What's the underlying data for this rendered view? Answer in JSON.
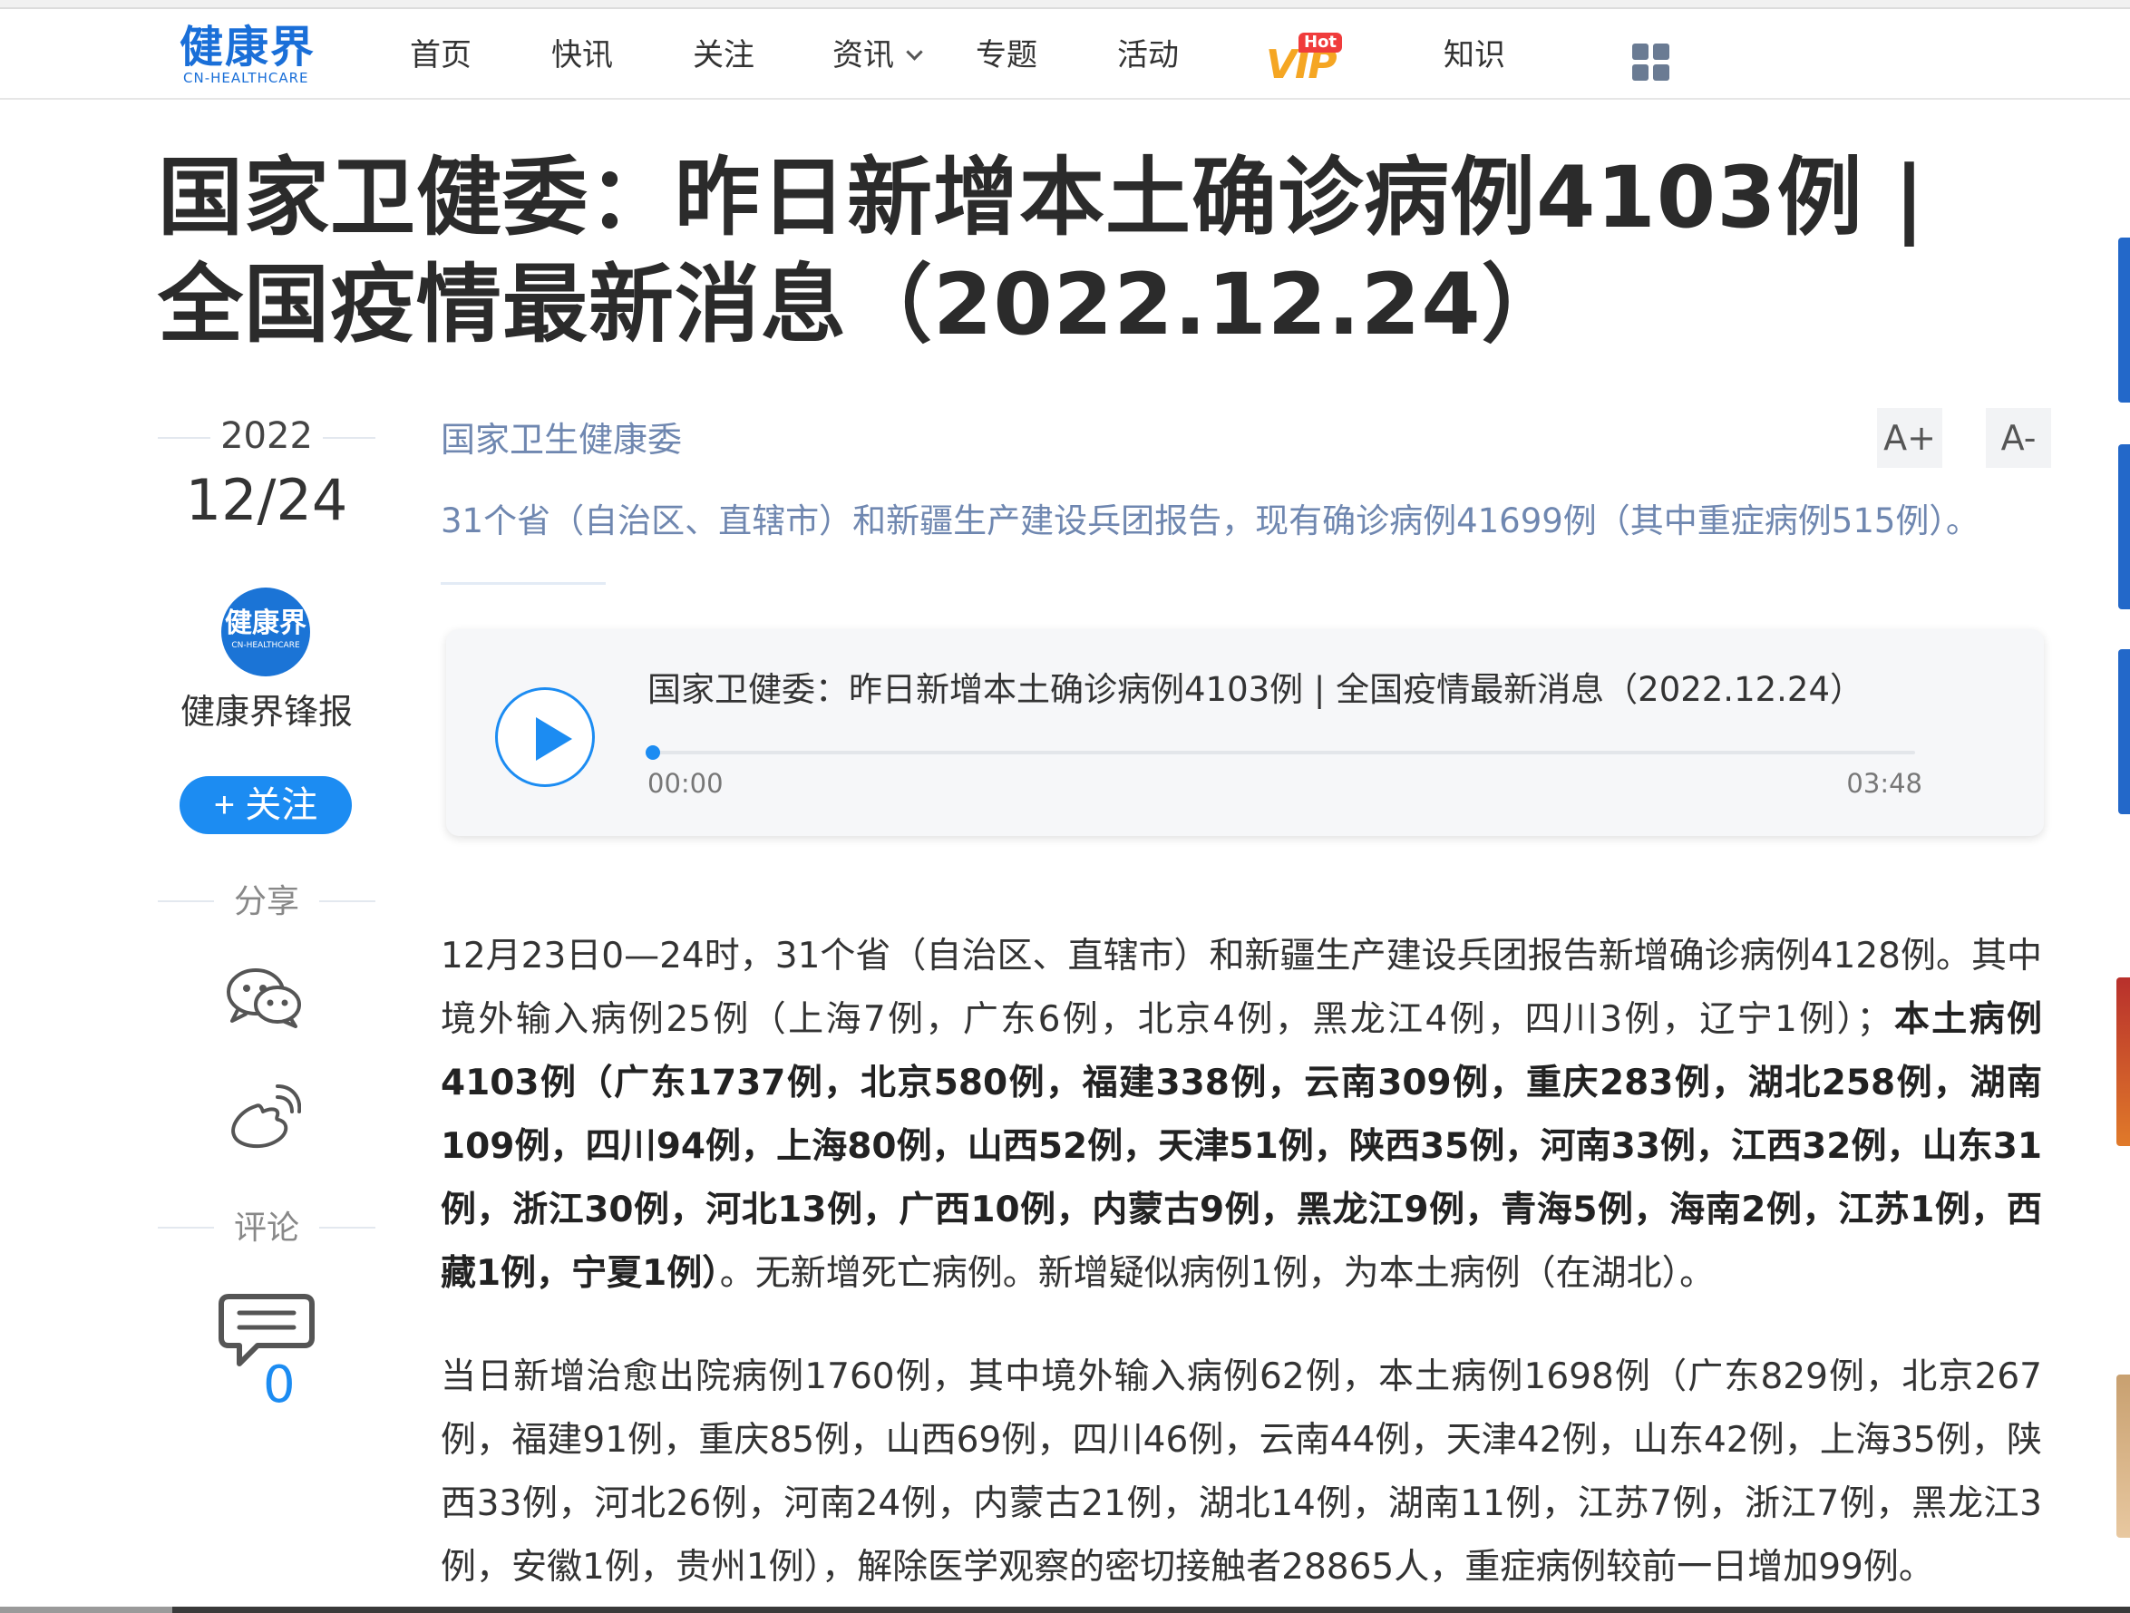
{
  "header": {
    "logo": {
      "main": "健康界",
      "sub": "CN-HEALTHCARE"
    },
    "nav": [
      "首页",
      "快讯",
      "关注",
      "资讯",
      "专题",
      "活动",
      "知识"
    ],
    "vip": {
      "label": "VIP",
      "badge": "Hot"
    }
  },
  "article": {
    "title": "国家卫健委：昨日新增本土确诊病例4103例 | 全国疫情最新消息（2022.12.24）",
    "year": "2022",
    "date": "12/24",
    "source": "国家卫生健康委",
    "summary": "31个省（自治区、直辖市）和新疆生产建设兵团报告，现有确诊病例41699例（其中重症病例515例）。",
    "font_increase": "A+",
    "font_decrease": "A-"
  },
  "author": {
    "avatar_main": "健康界",
    "avatar_sub": "CN-HEALTHCARE",
    "name": "健康界锋报",
    "follow_label": "+ 关注"
  },
  "sidebar": {
    "share_label": "分享",
    "comment_label": "评论",
    "comment_count": "0"
  },
  "audio": {
    "title": "国家卫健委：昨日新增本土确诊病例4103例 | 全国疫情最新消息（2022.12.24）",
    "current_time": "00:00",
    "total_time": "03:48",
    "progress": 0
  },
  "body": {
    "p1_part1": "12月23日0—24时，31个省（自治区、直辖市）和新疆生产建设兵团报告新增确诊病例4128例。其中境外输入病例25例（上海7例，广东6例，北京4例，黑龙江4例，四川3例，辽宁1例）；",
    "p1_bold": "本土病例4103例（广东1737例，北京580例，福建338例，云南309例，重庆283例，湖北258例，湖南109例，四川94例，上海80例，山西52例，天津51例，陕西35例，河南33例，江西32例，山东31例，浙江30例，河北13例，广西10例，内蒙古9例，黑龙江9例，青海5例，海南2例，江苏1例，西藏1例，宁夏1例）",
    "p1_part2": "。无新增死亡病例。新增疑似病例1例，为本土病例（在湖北）。",
    "p2": "当日新增治愈出院病例1760例，其中境外输入病例62例，本土病例1698例（广东829例，北京267例，福建91例，重庆85例，山西69例，四川46例，云南44例，天津42例，山东42例，上海35例，陕西33例，河北26例，河南24例，内蒙古21例，湖北14例，湖南11例，江苏7例，浙江7例，黑龙江3例，安徽1例，贵州1例），解除医学观察的密切接触者28865人，重症病例较前一日增加99例。"
  },
  "colors": {
    "brand_blue": "#1a6fd8",
    "accent_blue": "#1c8cf2",
    "muted_blue": "#6f87b0",
    "vip_orange": "#f5a623",
    "hot_red": "#f03c3c"
  }
}
